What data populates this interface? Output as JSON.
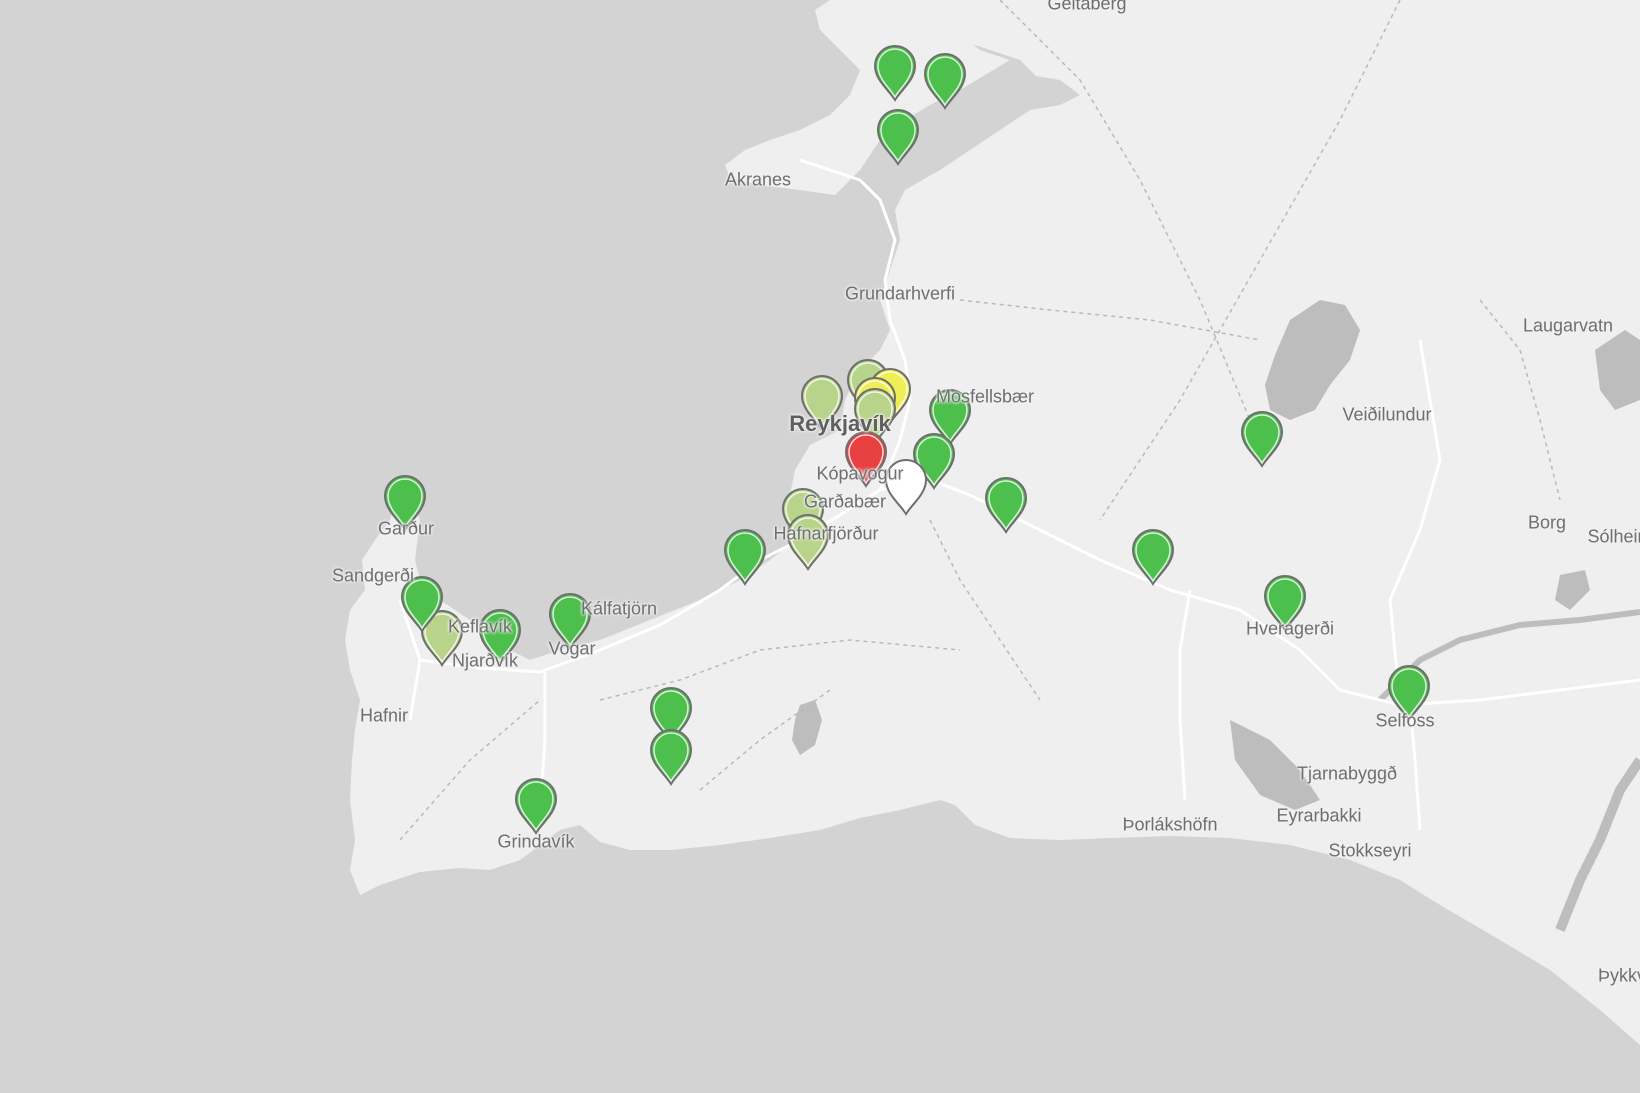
{
  "map": {
    "colors": {
      "water": "#d3d3d3",
      "land": "#efefef",
      "lake": "#bdbdbd",
      "road": "#ffffff",
      "track": "#b9b9b9",
      "marker_good": "#4cbf4c",
      "marker_fair": "#b8d38a",
      "marker_moderate": "#eeee55",
      "marker_poor": "#e84040",
      "marker_nodata": "#ffffff"
    },
    "places": [
      {
        "id": "geitaberg",
        "label": "Geitaberg"
      },
      {
        "id": "akranes",
        "label": "Akranes"
      },
      {
        "id": "grundarhverfi",
        "label": "Grundarhverfi"
      },
      {
        "id": "laugarvatn",
        "label": "Laugarvatn"
      },
      {
        "id": "mosfellsbaer",
        "label": "Mosfellsbær"
      },
      {
        "id": "reykjavik",
        "label": "Reykjavík",
        "type": "city"
      },
      {
        "id": "veidilundur",
        "label": "Veiðilundur"
      },
      {
        "id": "kopavogur",
        "label": "Kópavogur"
      },
      {
        "id": "gardabaer",
        "label": "Garðabær"
      },
      {
        "id": "hafnarfjordur",
        "label": "Hafnarfjörður"
      },
      {
        "id": "gardur",
        "label": "Garður"
      },
      {
        "id": "borg",
        "label": "Borg"
      },
      {
        "id": "solheimar",
        "label": "Sólheimar"
      },
      {
        "id": "sandgerdi",
        "label": "Sandgerði"
      },
      {
        "id": "kalfatjorn",
        "label": "Kálfatjörn"
      },
      {
        "id": "keflavik",
        "label": "Keflavík"
      },
      {
        "id": "njardvik",
        "label": "Njarðvík"
      },
      {
        "id": "vogar",
        "label": "Vogar"
      },
      {
        "id": "hveragerdi",
        "label": "Hveragerði"
      },
      {
        "id": "hafnir",
        "label": "Hafnir"
      },
      {
        "id": "selfoss",
        "label": "Selfoss"
      },
      {
        "id": "tjarnabyggd",
        "label": "Tjarnabyggð"
      },
      {
        "id": "eyrarbakki",
        "label": "Eyrarbakki"
      },
      {
        "id": "thorlakshofn",
        "label": "Þorlákshöfn"
      },
      {
        "id": "stokkseyri",
        "label": "Stokkseyri"
      },
      {
        "id": "thykkvibaer",
        "label": "Þykkvibær"
      },
      {
        "id": "grindavik",
        "label": "Grindavík"
      }
    ],
    "markers": [
      {
        "id": "m1",
        "status": "good"
      },
      {
        "id": "m2",
        "status": "good"
      },
      {
        "id": "m3",
        "status": "good"
      },
      {
        "id": "m4",
        "status": "fair"
      },
      {
        "id": "m5",
        "status": "fair"
      },
      {
        "id": "m6",
        "status": "moderate"
      },
      {
        "id": "m7",
        "status": "moderate"
      },
      {
        "id": "m8",
        "status": "fair"
      },
      {
        "id": "m9",
        "status": "good"
      },
      {
        "id": "m10",
        "status": "good"
      },
      {
        "id": "m11",
        "status": "poor"
      },
      {
        "id": "m12",
        "status": "nodata"
      },
      {
        "id": "m13",
        "status": "good"
      },
      {
        "id": "m14",
        "status": "good"
      },
      {
        "id": "m15",
        "status": "good"
      },
      {
        "id": "m16",
        "status": "good"
      },
      {
        "id": "m17",
        "status": "fair"
      },
      {
        "id": "m18",
        "status": "fair"
      },
      {
        "id": "m19",
        "status": "good"
      },
      {
        "id": "m20",
        "status": "good"
      },
      {
        "id": "m21",
        "status": "fair"
      },
      {
        "id": "m22",
        "status": "good"
      },
      {
        "id": "m23",
        "status": "good"
      },
      {
        "id": "m24",
        "status": "good"
      },
      {
        "id": "m25",
        "status": "good"
      },
      {
        "id": "m26",
        "status": "good"
      },
      {
        "id": "m27",
        "status": "good"
      },
      {
        "id": "m28",
        "status": "good"
      }
    ]
  }
}
